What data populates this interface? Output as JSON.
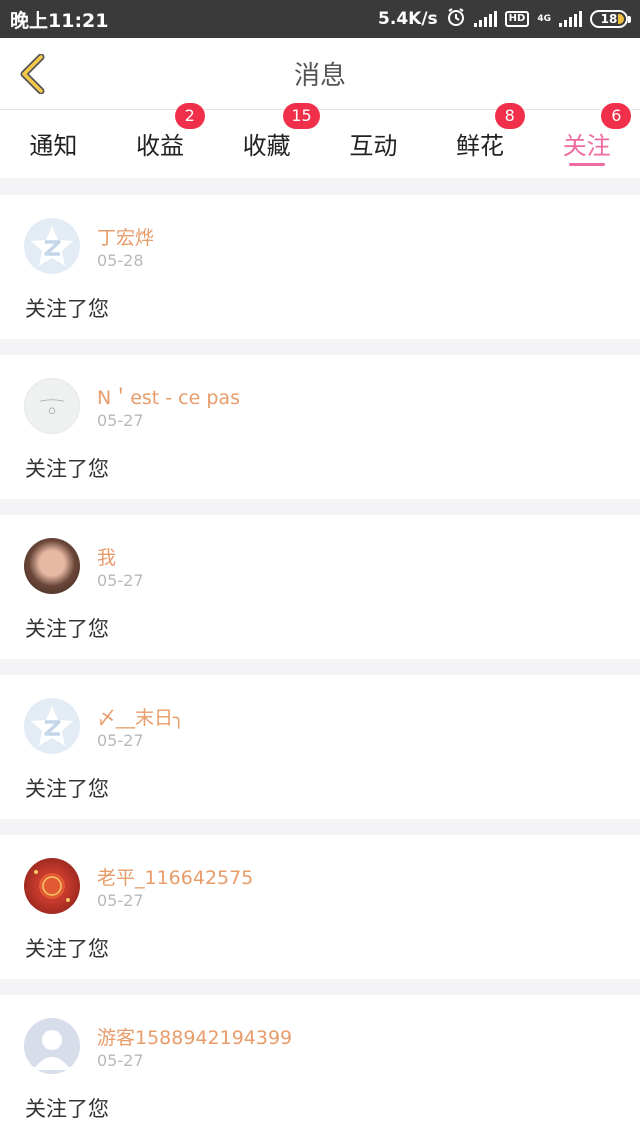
{
  "status_bar": {
    "time": "晚上11:21",
    "speed": "5.4K/s",
    "hd": "HD",
    "net": "4G",
    "battery": "18"
  },
  "header": {
    "title": "消息"
  },
  "tabs": [
    {
      "label": "通知",
      "badge": ""
    },
    {
      "label": "收益",
      "badge": "2"
    },
    {
      "label": "收藏",
      "badge": "15"
    },
    {
      "label": "互动",
      "badge": ""
    },
    {
      "label": "鲜花",
      "badge": "8"
    },
    {
      "label": "关注",
      "badge": "6"
    }
  ],
  "active_tab": "关注",
  "colors": {
    "accent": "#f06aa2",
    "badge": "#f0304a",
    "name": "#e89c6a"
  },
  "messages": [
    {
      "name": "丁宏烨",
      "date": "05-28",
      "text": "关注了您",
      "avatar": "default-avatar-icon"
    },
    {
      "name": "N＇est - ce pas",
      "date": "05-27",
      "text": "关注了您",
      "avatar": "sketch-avatar"
    },
    {
      "name": "我",
      "date": "05-27",
      "text": "关注了您",
      "avatar": "photo-avatar"
    },
    {
      "name": "〆__末日╮",
      "date": "05-27",
      "text": "关注了您",
      "avatar": "default-avatar-icon"
    },
    {
      "name": "老平_116642575",
      "date": "05-27",
      "text": "关注了您",
      "avatar": "red-lantern-avatar"
    },
    {
      "name": "游客1588942194399",
      "date": "05-27",
      "text": "关注了您",
      "avatar": "guest-avatar-icon"
    }
  ]
}
